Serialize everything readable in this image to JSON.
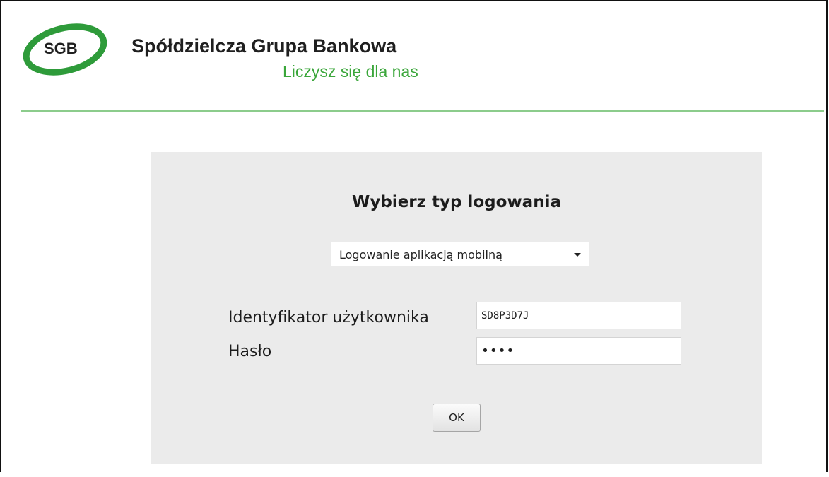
{
  "header": {
    "logo_text": "SGB",
    "brand_name": "Spółdzielcza Grupa Bankowa",
    "tagline": "Liczysz się dla nas"
  },
  "colors": {
    "brand_green": "#3aa63a",
    "panel_bg": "#ebebeb",
    "rule_green": "#8ccc8c"
  },
  "login": {
    "title": "Wybierz typ logowania",
    "login_type": {
      "selected": "Logowanie aplikacją mobilną",
      "icon": "chevron-down-icon"
    },
    "user_id": {
      "label": "Identyfikator użytkownika",
      "value": "SD8P3D7J"
    },
    "password": {
      "label": "Hasło",
      "value": "••••"
    },
    "submit_label": "OK"
  }
}
